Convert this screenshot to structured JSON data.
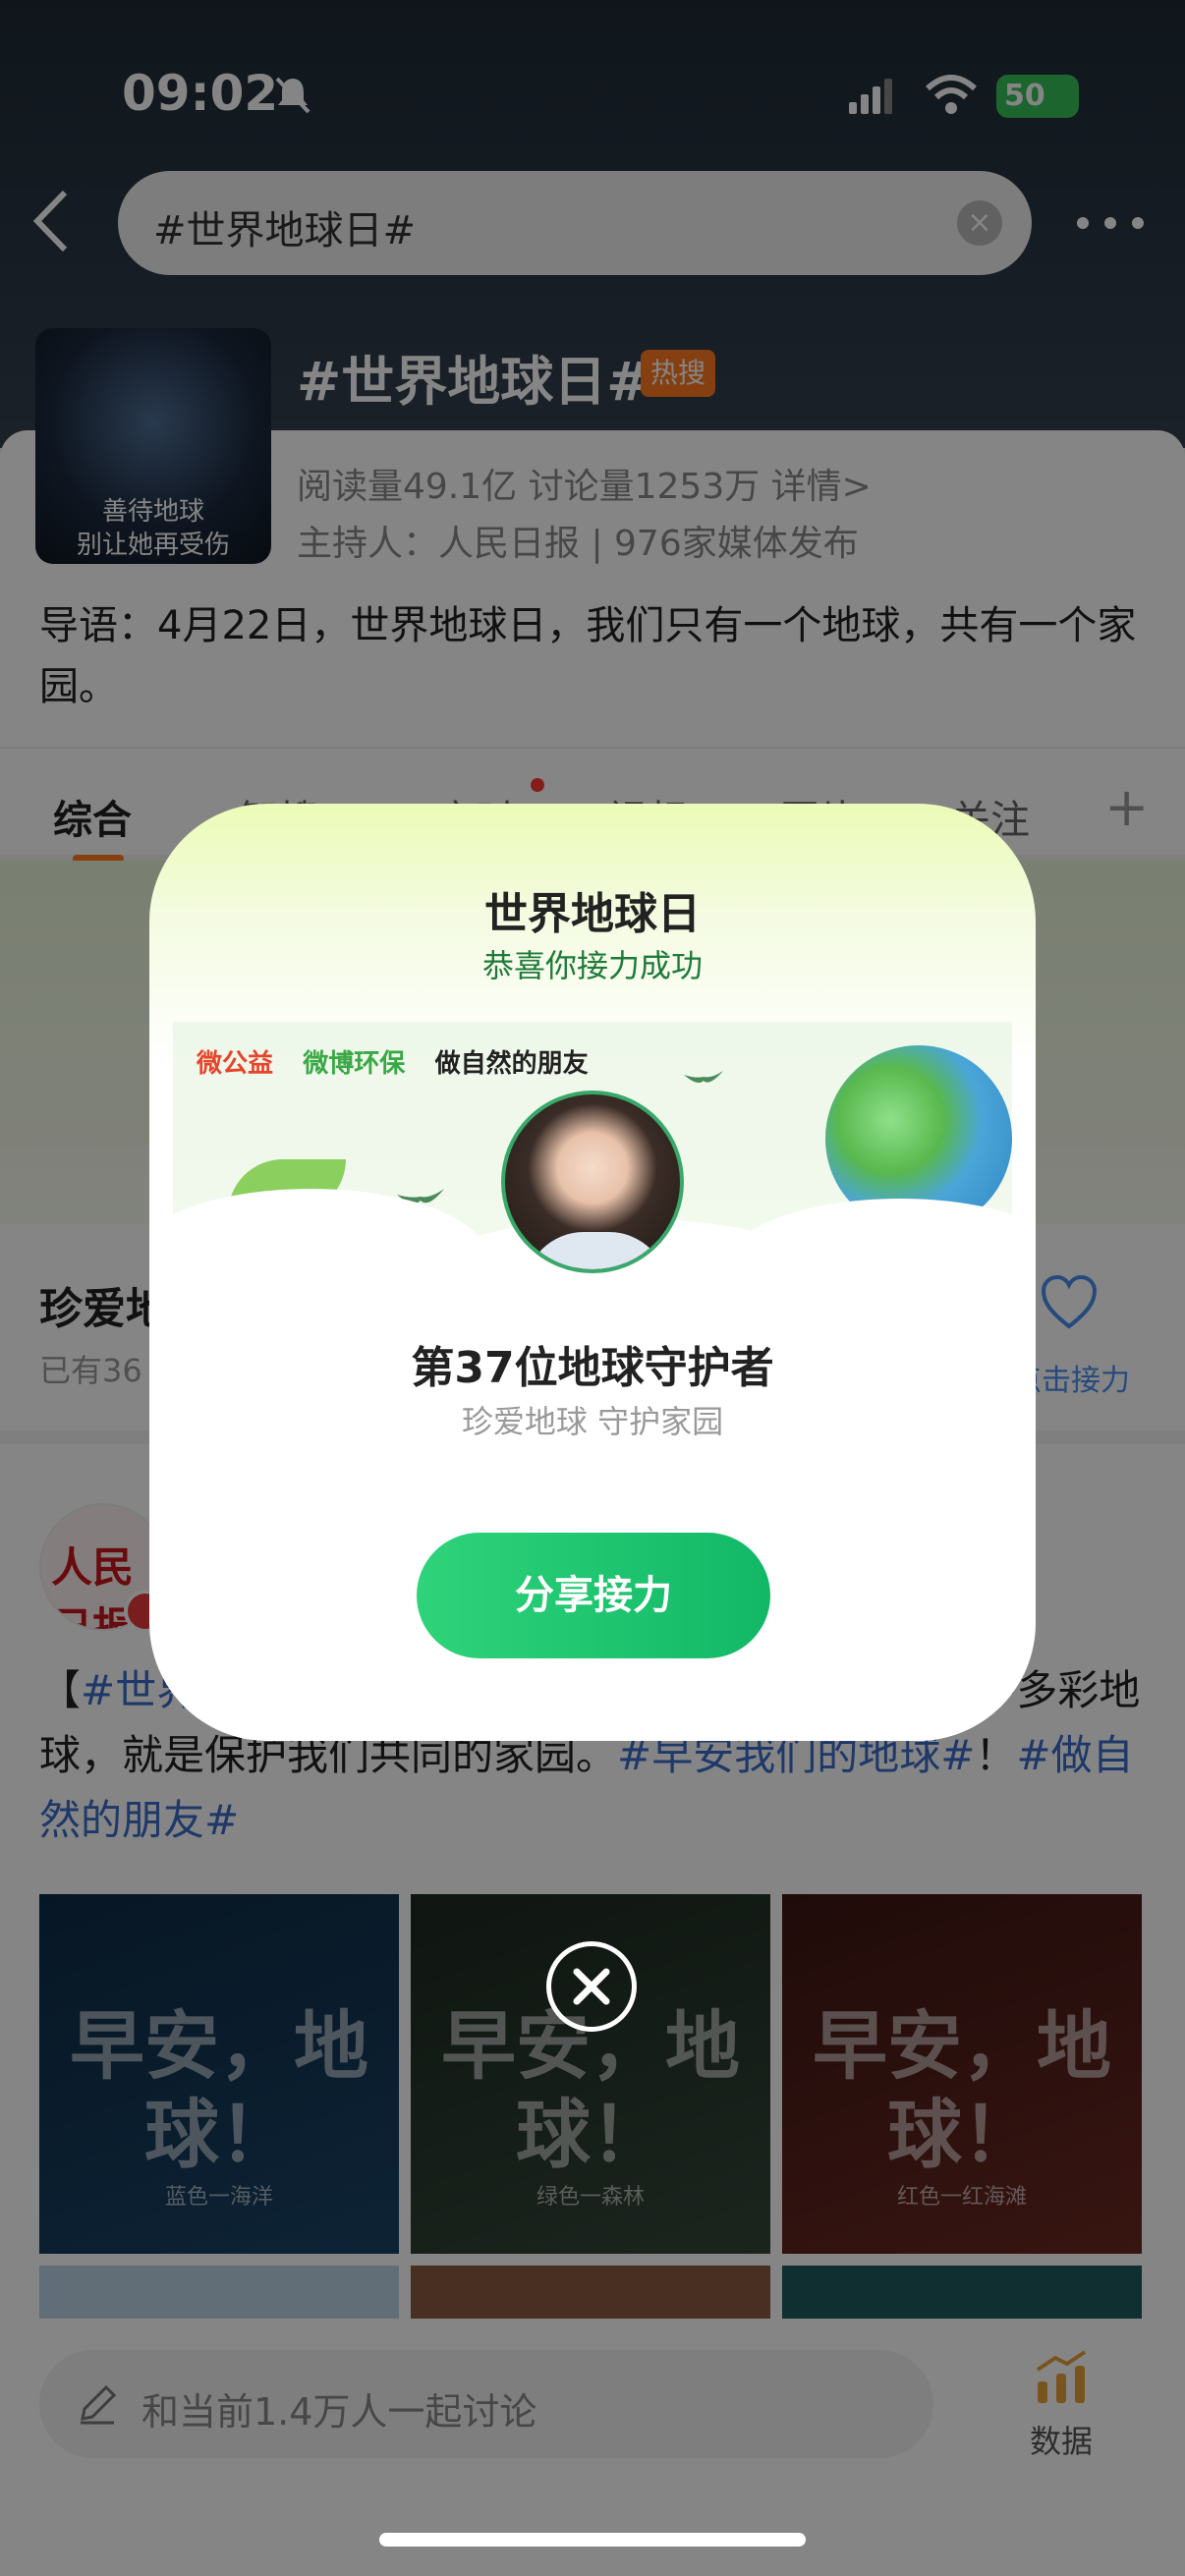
{
  "status_bar": {
    "time": "09:02",
    "battery": "50"
  },
  "search": {
    "query": "#世界地球日#"
  },
  "topic": {
    "cover_line1": "善待地球",
    "cover_line2": "别让她再受伤",
    "title": "#世界地球日#",
    "hot_badge": "热搜",
    "stats": "阅读量49.1亿   讨论量1253万   详情>",
    "host": "主持人：人民日报 | 976家媒体发布",
    "intro": "导语：4月22日，世界地球日，我们只有一个地球，共有一个家园。"
  },
  "tabs": {
    "items": [
      "综合",
      "智搜",
      "实时",
      "视频",
      "图片",
      "关注"
    ],
    "add": "+"
  },
  "relay": {
    "title": "珍爱地球",
    "count": "已有36",
    "button_label": "点击接力"
  },
  "post": {
    "avatar_text": "人民日报",
    "text_prefix": "【",
    "tag_1": "#世界地球日#",
    "text_middle": "】深海蓝、森林绿、冰川白……守护多彩地球，就是保护我们共同的家园。",
    "tag_2": "#早安我们的地球#",
    "text_sep": "！",
    "tag_3": "#做自然的朋友#",
    "images": [
      {
        "caption": "早安，地球！",
        "sub": "蓝色一海洋"
      },
      {
        "caption": "早安，地球！",
        "sub": "绿色一森林"
      },
      {
        "caption": "早安，地球！",
        "sub": "红色一红海滩"
      }
    ]
  },
  "bottom_bar": {
    "comment_placeholder": "和当前1.4万人一起讨论",
    "data_label": "数据"
  },
  "modal": {
    "title": "世界地球日",
    "subtitle": "恭喜你接力成功",
    "logos": [
      "微公益",
      "微博环保",
      "做自然的朋友"
    ],
    "guardian_title": "第37位地球守护者",
    "guardian_sub": "珍爱地球 守护家园",
    "share_button": "分享接力"
  },
  "colors": {
    "accent": "#ff7a22",
    "share_button": "#12b866",
    "hashtag": "#3a6bc9"
  }
}
